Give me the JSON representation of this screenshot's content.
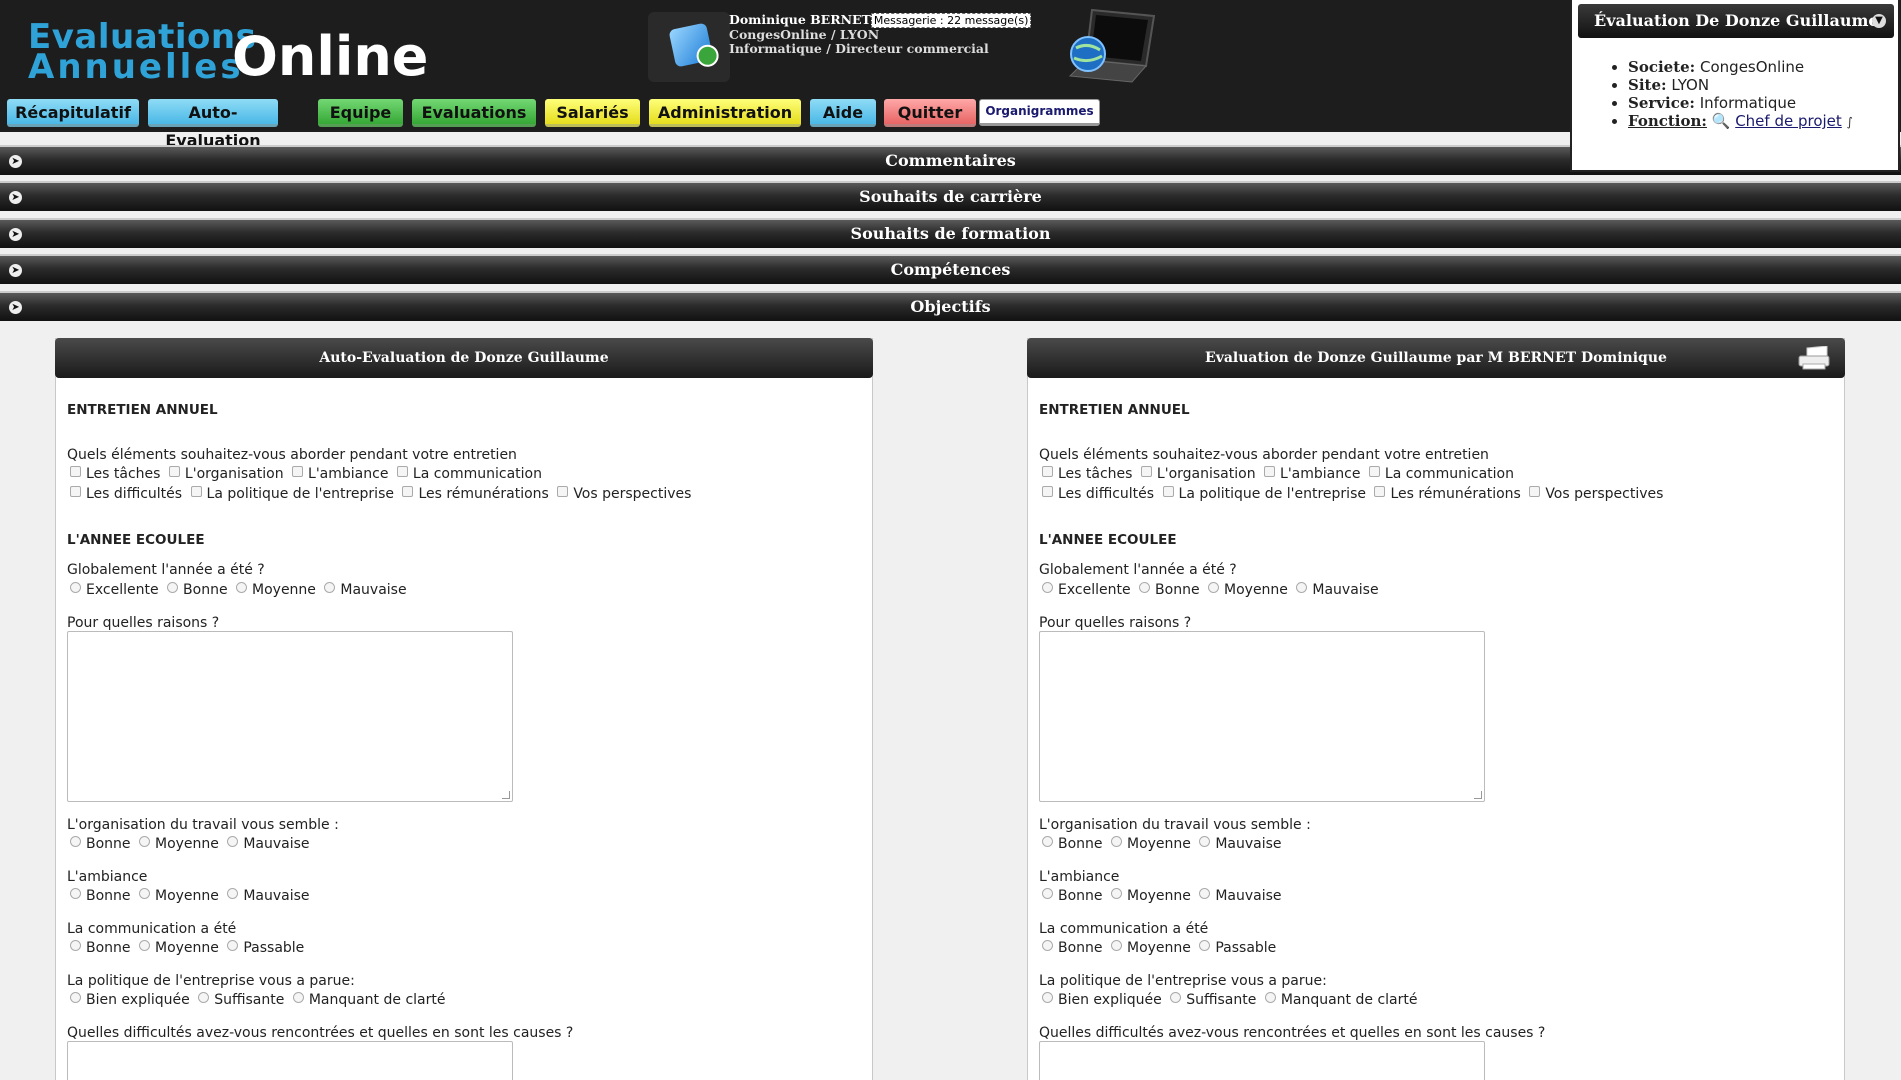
{
  "logo": {
    "line1": "Evaluations",
    "line2": "Annuelles",
    "online": "Online"
  },
  "user": {
    "name": "Dominique BERNET",
    "messages": "Messagerie : 22 message(s)",
    "company_site": "CongesOnline / LYON",
    "dept_role": "Informatique / Directeur commercial"
  },
  "nav": [
    {
      "label": "Récapitulatif",
      "color": "blue"
    },
    {
      "label": "Auto-Evaluation",
      "color": "blue"
    },
    {
      "label": "Equipe",
      "color": "green"
    },
    {
      "label": "Evaluations",
      "color": "green"
    },
    {
      "label": "Salariés",
      "color": "yellow"
    },
    {
      "label": "Administration",
      "color": "yellow"
    },
    {
      "label": "Aide",
      "color": "blue"
    },
    {
      "label": "Quitter",
      "color": "red"
    },
    {
      "label": "Organigrammes",
      "color": "white"
    }
  ],
  "info_panel": {
    "title": "Évaluation De Donze Guillaume",
    "societe_label": "Societe:",
    "societe": "CongesOnline",
    "site_label": "Site:",
    "site": "LYON",
    "service_label": "Service:",
    "service": "Informatique",
    "fonction_label": "Fonction:",
    "fonction": "Chef de projet"
  },
  "sections": [
    "Commentaires",
    "Souhaits de carrière",
    "Souhaits de formation",
    "Compétences",
    "Objectifs"
  ],
  "panels": [
    {
      "title": "Auto-Evaluation de Donze Guillaume",
      "printable": false
    },
    {
      "title": "Evaluation de Donze Guillaume par M BERNET Dominique",
      "printable": true
    }
  ],
  "form": {
    "section1": "ENTRETIEN ANNUEL",
    "q_elements": "Quels éléments souhaitez-vous aborder pendant votre entretien",
    "elements_row1": [
      "Les tâches",
      "L'organisation",
      "L'ambiance",
      "La communication"
    ],
    "elements_row2": [
      "Les difficultés",
      "La politique de l'entreprise",
      "Les rémunérations",
      "Vos perspectives"
    ],
    "section2": "L'ANNEE ECOULEE",
    "q_annee": "Globalement l'année a été ?",
    "annee_opts": [
      "Excellente",
      "Bonne",
      "Moyenne",
      "Mauvaise"
    ],
    "q_raisons": "Pour quelles raisons ?",
    "q_organisation": "L'organisation du travail vous semble :",
    "organisation_opts": [
      "Bonne",
      "Moyenne",
      "Mauvaise"
    ],
    "q_ambiance": "L'ambiance",
    "ambiance_opts": [
      "Bonne",
      "Moyenne",
      "Mauvaise"
    ],
    "q_communication": "La communication a été",
    "communication_opts": [
      "Bonne",
      "Moyenne",
      "Passable"
    ],
    "q_politique": "La politique de l'entreprise vous a parue:",
    "politique_opts": [
      "Bien expliquée",
      "Suffisante",
      "Manquant de clarté"
    ],
    "q_difficultes": "Quelles difficultés avez-vous rencontrées et quelles en sont les causes ?"
  }
}
